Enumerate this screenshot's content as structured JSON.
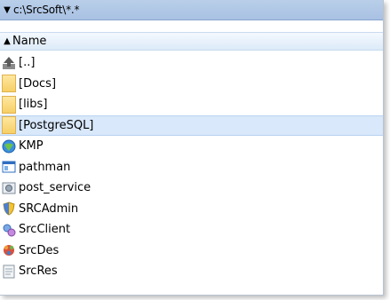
{
  "path": {
    "text": "c:\\SrcSoft\\*.*"
  },
  "header": {
    "name": "Name"
  },
  "rows": [
    {
      "label": "[..]",
      "icon": "up-folder-icon"
    },
    {
      "label": "[Docs]",
      "icon": "folder-icon"
    },
    {
      "label": "[libs]",
      "icon": "folder-icon"
    },
    {
      "label": "[PostgreSQL]",
      "icon": "folder-icon",
      "selected": true
    },
    {
      "label": "KMP",
      "icon": "globe-app-icon"
    },
    {
      "label": "pathman",
      "icon": "window-app-icon"
    },
    {
      "label": "post_service",
      "icon": "service-app-icon"
    },
    {
      "label": "SRCAdmin",
      "icon": "shield-app-icon"
    },
    {
      "label": "SrcClient",
      "icon": "gears-app-icon"
    },
    {
      "label": "SrcDes",
      "icon": "colorful-app-icon"
    },
    {
      "label": "SrcRes",
      "icon": "document-app-icon"
    }
  ],
  "colors": {
    "path_bar": "#b5cce9",
    "selection": "#d9e8fa",
    "folder": "#f6cf66"
  }
}
